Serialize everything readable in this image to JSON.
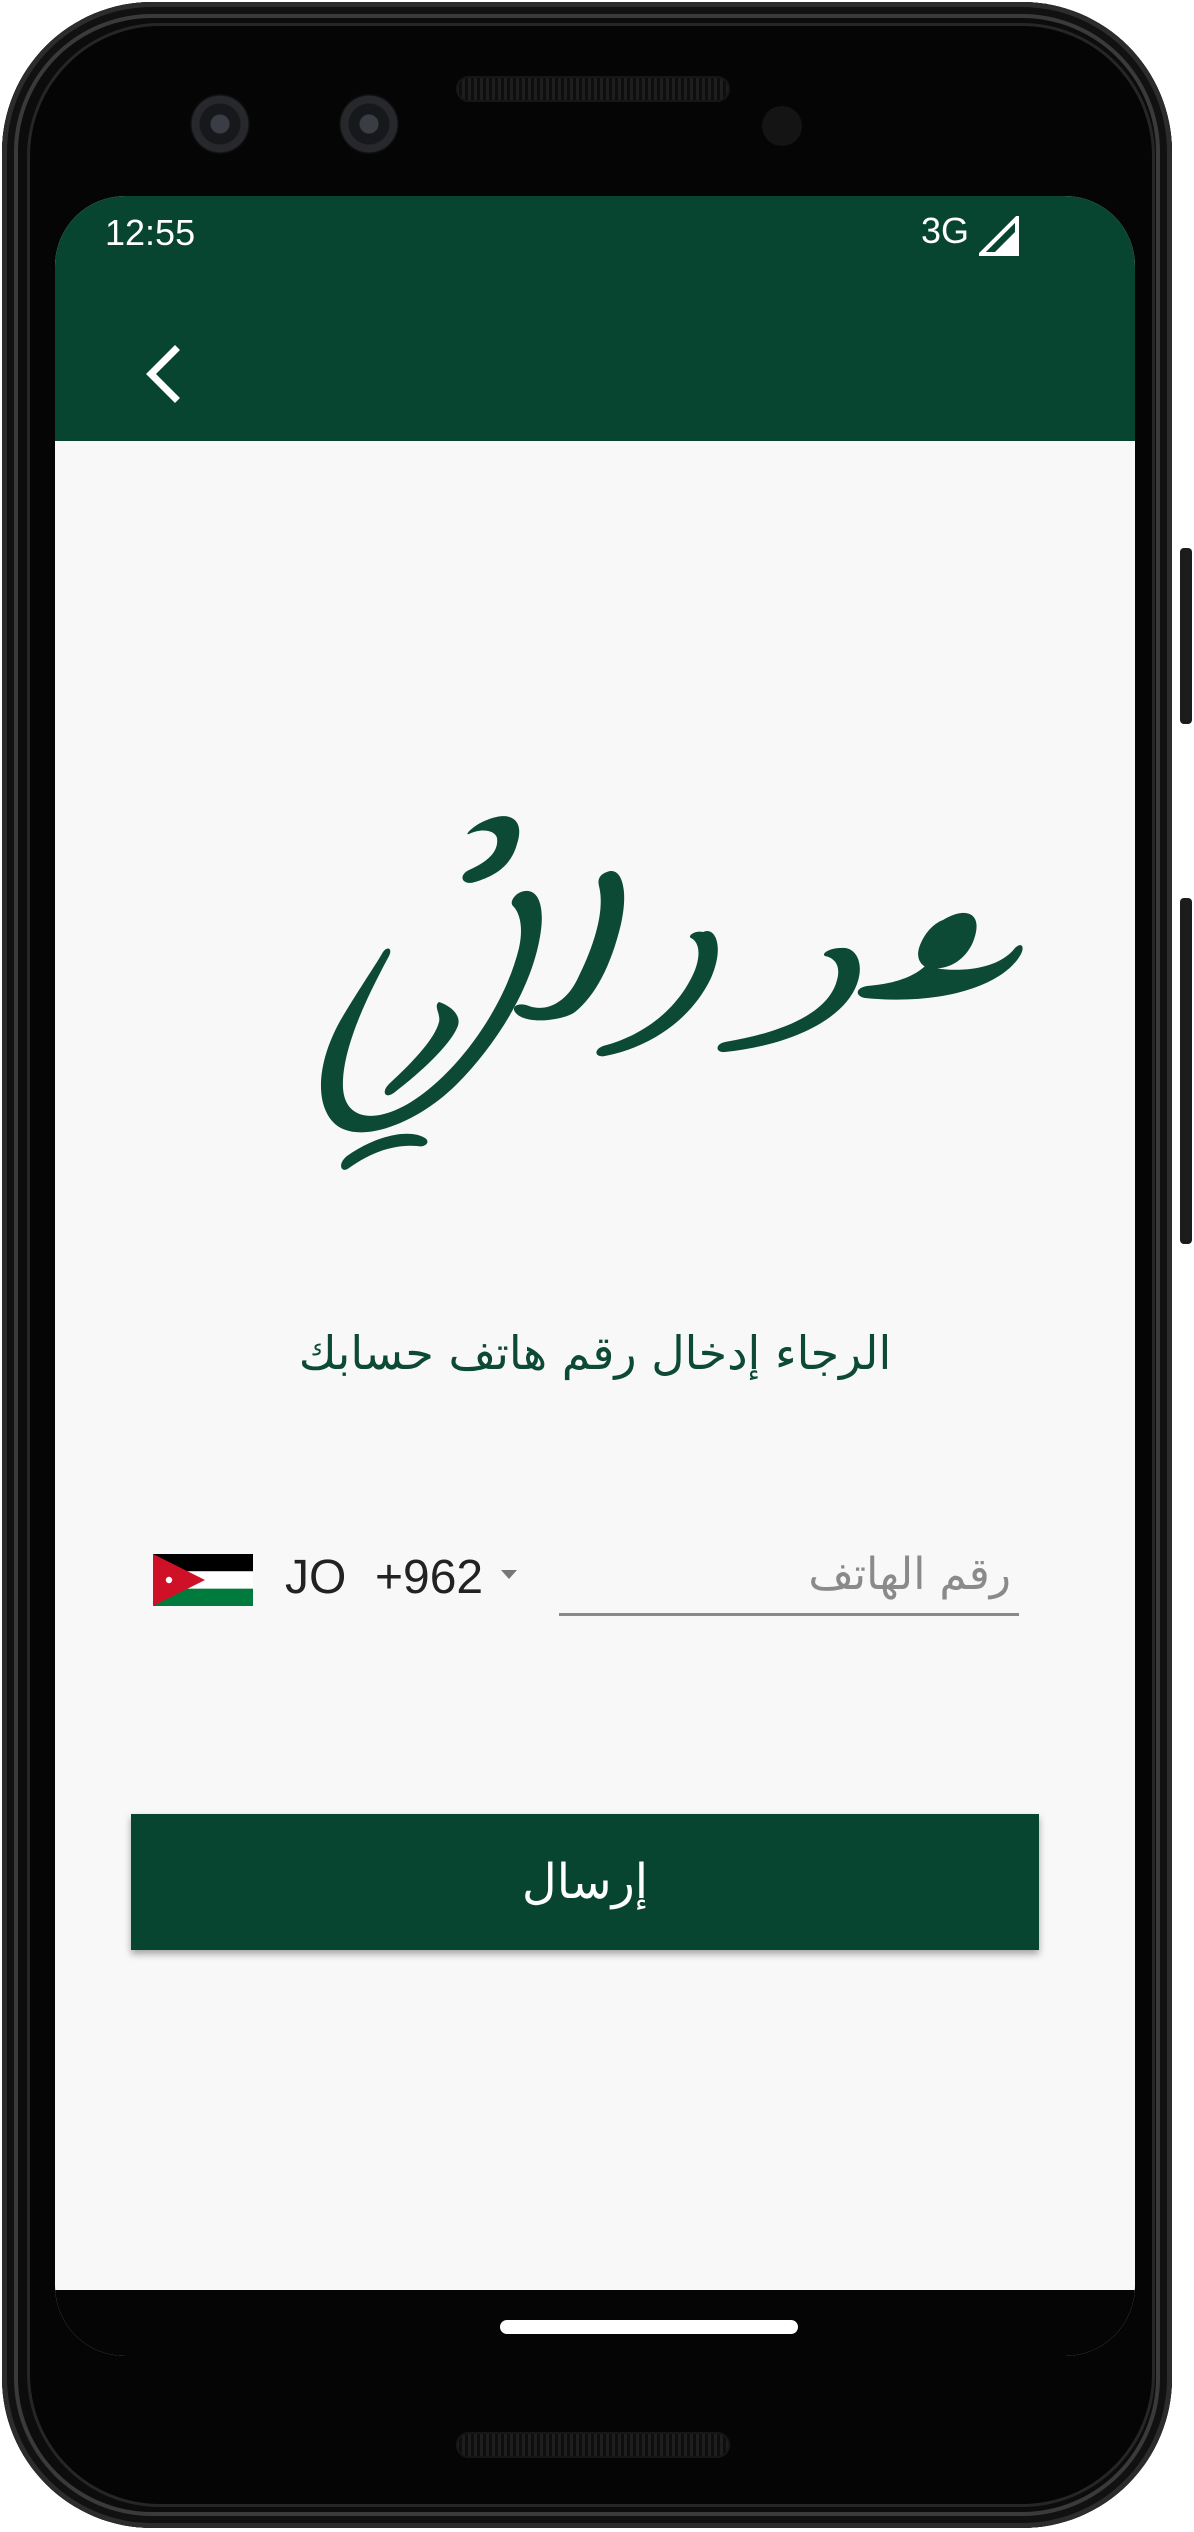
{
  "status_bar": {
    "time": "12:55",
    "network": "3G",
    "signal_icon": "cell-signal-icon"
  },
  "app_bar": {
    "back_icon": "chevron-left-icon",
    "color": "#084531"
  },
  "logo": {
    "text": "مدرستي",
    "color": "#0c4a35"
  },
  "instruction": "الرجاء إدخال رقم هاتف حسابك",
  "phone": {
    "flag_icon": "jordan-flag-icon",
    "country_code": "JO",
    "dial_code": "+962",
    "dropdown_icon": "caret-down-icon",
    "placeholder": "رقم الهاتف",
    "value": ""
  },
  "send_button": {
    "label": "إرسال",
    "color": "#084531"
  }
}
